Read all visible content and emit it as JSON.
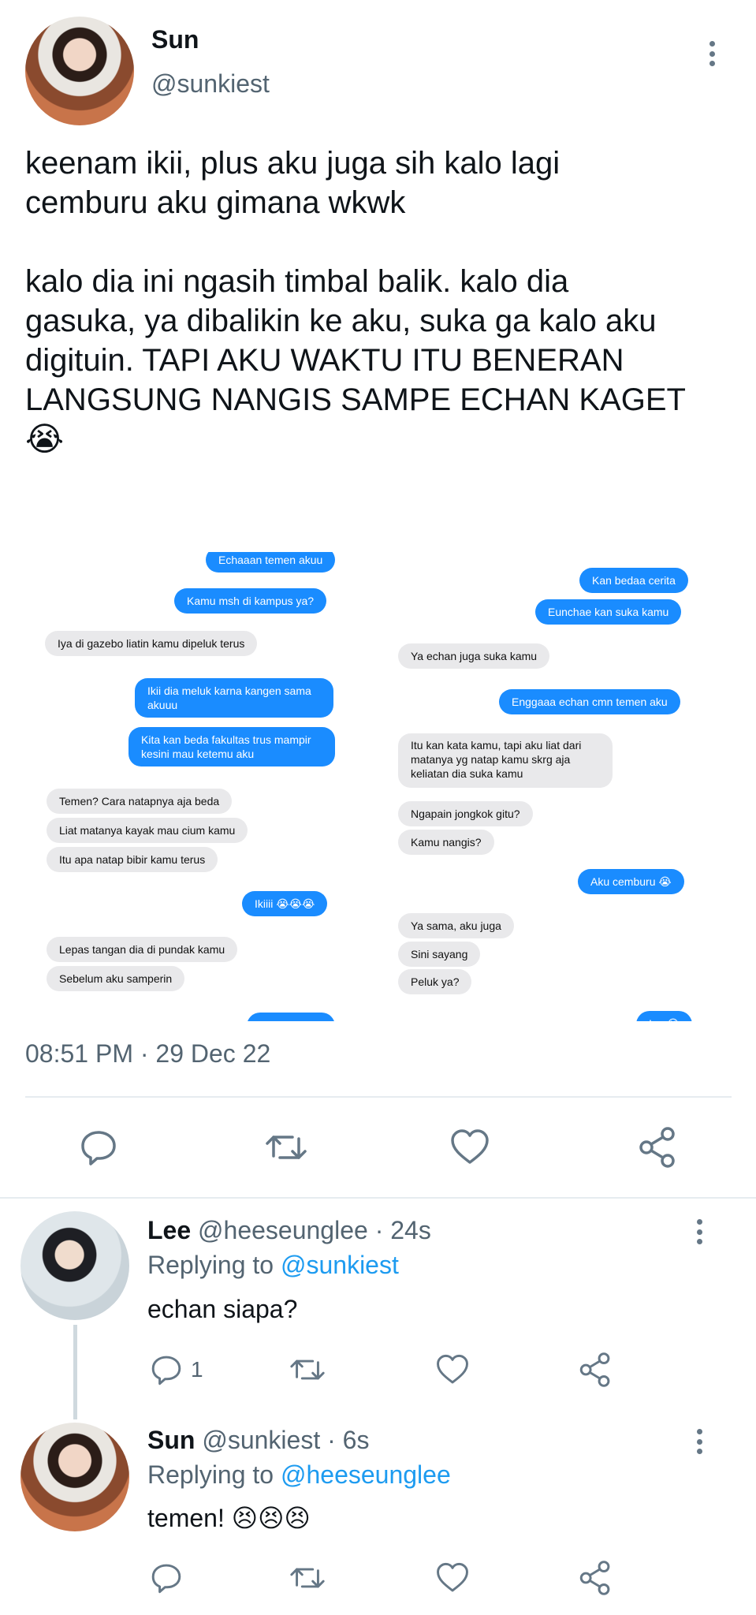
{
  "main_tweet": {
    "name": "Sun",
    "handle": "@sunkiest",
    "text_line1": "keenam ikii, plus aku juga sih kalo lagi",
    "text_line2": "cemburu aku gimana wkwk",
    "text_line3": "kalo dia ini ngasih timbal balik. kalo dia",
    "text_line4": "gasuka, ya dibalikin ke aku, suka ga kalo aku",
    "text_line5": "digituin. TAPI AKU WAKTU ITU BENERAN",
    "text_line6": "LANGSUNG NANGIS SAMPE ECHAN KAGET",
    "emoji": "😭",
    "timestamp": "08:51 PM · 29 Dec 22"
  },
  "chat_left": [
    {
      "text": "Echaaan temen akuu",
      "from": "me"
    },
    {
      "text": "Kamu msh di kampus ya?",
      "from": "me"
    },
    {
      "text": "Iya di gazebo liatin kamu dipeluk terus",
      "from": "them"
    },
    {
      "text": "Ikii dia meluk karna kangen sama",
      "text2": "akuuu",
      "from": "me"
    },
    {
      "text": "Kita kan beda fakultas trus mampir",
      "text2": "kesini mau ketemu aku",
      "from": "me"
    },
    {
      "text": "Temen? Cara natapnya aja beda",
      "from": "them"
    },
    {
      "text": "Liat matanya kayak mau cium kamu",
      "from": "them"
    },
    {
      "text": "Itu apa natap bibir kamu terus",
      "from": "them"
    },
    {
      "text": "Ikiiii 😭😭😭",
      "from": "me"
    },
    {
      "text": "Lepas tangan dia di pundak kamu",
      "from": "them"
    },
    {
      "text": "Sebelum aku samperin",
      "from": "them"
    }
  ],
  "chat_right": [
    {
      "text": "Kan bedaa cerita",
      "from": "me"
    },
    {
      "text": "Eunchae kan suka kamu",
      "from": "me"
    },
    {
      "text": "Ya echan juga suka kamu",
      "from": "them"
    },
    {
      "text": "Enggaaa echan cmn temen aku",
      "from": "me"
    },
    {
      "text": "Itu kan kata kamu, tapi aku liat dari",
      "text2": "matanya yg natap kamu skrg aja",
      "text3": "keliatan dia suka kamu",
      "from": "them"
    },
    {
      "text": "Ngapain jongkok gitu?",
      "from": "them"
    },
    {
      "text": "Kamu nangis?",
      "from": "them"
    },
    {
      "text": "Aku cemburu 😭",
      "from": "me"
    },
    {
      "text": "Ya sama, aku juga",
      "from": "them"
    },
    {
      "text": "Sini sayang",
      "from": "them"
    },
    {
      "text": "Peluk ya?",
      "from": "them"
    },
    {
      "text": "Iya 😭",
      "from": "me"
    }
  ],
  "reply1": {
    "name": "Lee",
    "handle_time": "@heeseunglee · 24s",
    "replying_prefix": "Replying to",
    "replying_to": "@sunkiest",
    "text": "echan siapa?",
    "reply_count": "1"
  },
  "reply2": {
    "name": "Sun",
    "handle_time": "@sunkiest · 6s",
    "replying_prefix": "Replying to",
    "replying_to": "@heeseunglee",
    "text": "temen! 😣😣😣"
  },
  "icons": {
    "reply": "comment-icon",
    "retweet": "retweet-icon",
    "like": "heart-icon",
    "share": "share-icon",
    "more": "more-vertical-icon"
  },
  "colors": {
    "text": "#0f1419",
    "muted": "#536471",
    "link": "#1d9bf0",
    "imessage_blue": "#1a8cff",
    "imessage_gray": "#e9e9eb",
    "icon": "#657786"
  }
}
